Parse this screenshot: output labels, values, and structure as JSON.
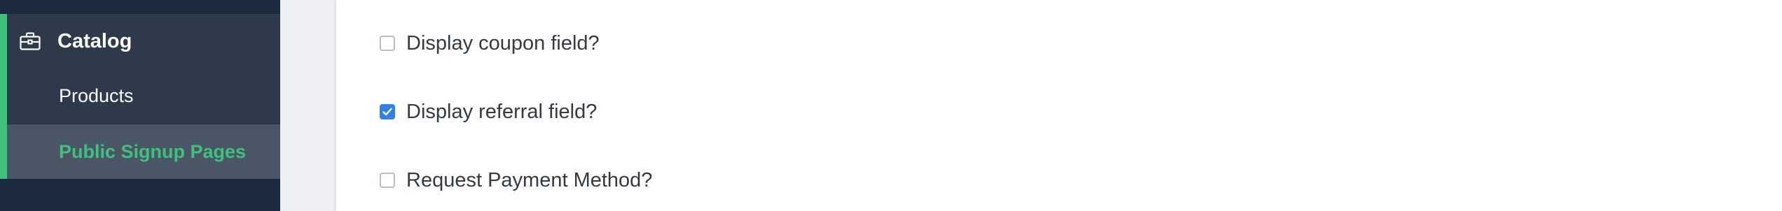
{
  "sidebar": {
    "section": {
      "label": "Catalog",
      "icon": "briefcase-icon",
      "accent_color": "#3ec17c"
    },
    "items": [
      {
        "label": "Products",
        "active": false
      },
      {
        "label": "Public Signup Pages",
        "active": true
      }
    ]
  },
  "options": [
    {
      "label": "Display coupon field?",
      "checked": false
    },
    {
      "label": "Display referral field?",
      "checked": true
    },
    {
      "label": "Request Payment Method?",
      "checked": false
    }
  ],
  "colors": {
    "sidebar_bg": "#1c2a3f",
    "sidebar_section_bg": "#2e3a4b",
    "active_item_bg": "#4a5565",
    "accent": "#3ec17c",
    "checkbox_checked": "#2f80ed"
  }
}
